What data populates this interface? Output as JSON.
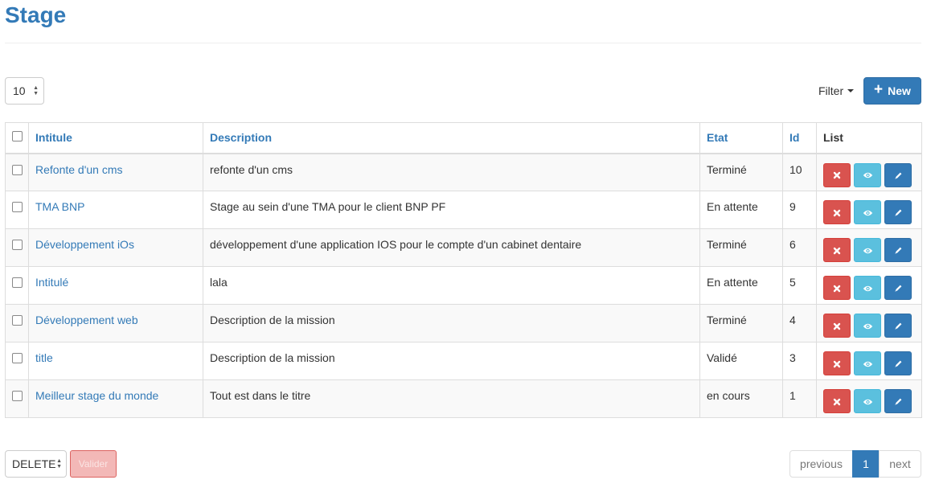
{
  "page": {
    "title": "Stage"
  },
  "toolbar": {
    "per_page_value": "10",
    "filter_label": "Filter",
    "new_label": "New"
  },
  "table": {
    "headers": {
      "intitule": "Intitule",
      "description": "Description",
      "etat": "Etat",
      "id": "Id",
      "list": "List"
    },
    "rows": [
      {
        "intitule": "Refonte d'un cms",
        "description": "refonte d'un cms",
        "etat": "Terminé",
        "id": "10"
      },
      {
        "intitule": "TMA BNP",
        "description": "Stage au sein d'une TMA pour le client BNP PF",
        "etat": "En attente",
        "id": "9"
      },
      {
        "intitule": "Développement iOs",
        "description": "développement d'une application IOS pour le compte d'un cabinet dentaire",
        "etat": "Terminé",
        "id": "6"
      },
      {
        "intitule": "Intitulé",
        "description": "lala",
        "etat": "En attente",
        "id": "5"
      },
      {
        "intitule": "Développement web",
        "description": "Description de la mission",
        "etat": "Terminé",
        "id": "4"
      },
      {
        "intitule": "title",
        "description": "Description de la mission",
        "etat": "Validé",
        "id": "3"
      },
      {
        "intitule": "Meilleur stage du monde",
        "description": "Tout est dans le titre",
        "etat": "en cours",
        "id": "1"
      }
    ]
  },
  "bulk": {
    "action_value": "DELETE",
    "submit_label": "Valider"
  },
  "pagination": {
    "previous_label": "previous",
    "current_page": "1",
    "next_label": "next"
  },
  "colors": {
    "primary": "#337ab7",
    "danger": "#d9534f",
    "info": "#5bc0de"
  },
  "icons": {
    "delete": "close-icon",
    "view": "eye-icon",
    "edit": "pencil-icon",
    "new": "plus-icon"
  }
}
